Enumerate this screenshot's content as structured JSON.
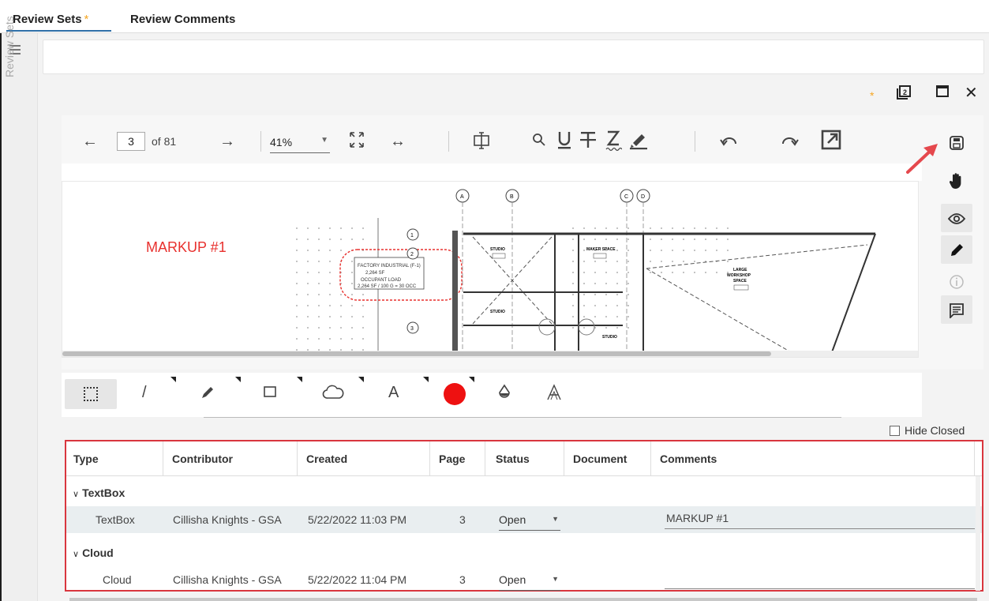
{
  "tabs": [
    {
      "label": "Review Sets",
      "marker": "*"
    },
    {
      "label": "Review Comments"
    }
  ],
  "rail": {
    "label": "Review Sets",
    "menu_icon": "hamburger-icon"
  },
  "window_controls": {
    "star": "*",
    "popout_icon": "popout-icon",
    "maximize_icon": "maximize-icon",
    "close_icon": "close-icon"
  },
  "viewer": {
    "page": "3",
    "of_pages": "of 81",
    "zoom": "41%",
    "markup_text": "MARKUP #1"
  },
  "right_tools": [
    "save-icon",
    "hand-icon",
    "eye-icon",
    "pencil-icon",
    "info-icon",
    "comment-icon"
  ],
  "draw_tools": [
    "select-icon",
    "line-icon",
    "highlighter-icon",
    "rectangle-icon",
    "cloud-icon",
    "text-icon",
    "color-icon",
    "fill-icon",
    "font-outline-icon"
  ],
  "colors": {
    "accent": "#2f6fa7",
    "markup": "#e8312e",
    "highlight_border": "#d9363e",
    "pen_color": "#ee1111"
  },
  "hide_closed": {
    "label": "Hide Closed",
    "checked": false
  },
  "table": {
    "columns": [
      "Type",
      "Contributor",
      "Created",
      "Page",
      "Status",
      "Document",
      "Comments"
    ],
    "groups": [
      {
        "name": "TextBox",
        "rows": [
          {
            "type": "TextBox",
            "contributor": "Cillisha Knights - GSA",
            "created": "5/22/2022 11:03 PM",
            "page": "3",
            "status": "Open",
            "document": "",
            "comments": "MARKUP #1"
          }
        ]
      },
      {
        "name": "Cloud",
        "rows": [
          {
            "type": "Cloud",
            "contributor": "Cillisha Knights - GSA",
            "created": "5/22/2022 11:04 PM",
            "page": "3",
            "status": "Open",
            "document": "",
            "comments": ""
          }
        ]
      }
    ]
  }
}
